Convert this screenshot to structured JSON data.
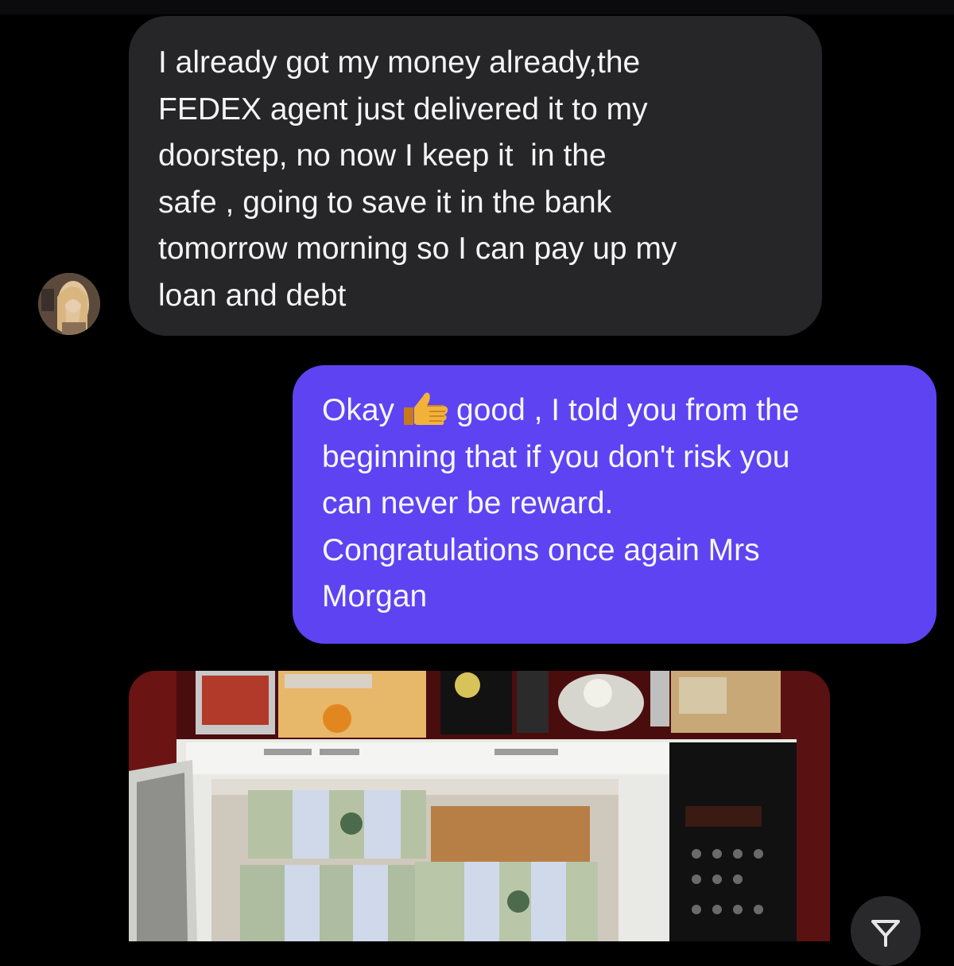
{
  "conversation": {
    "incoming": {
      "lines": [
        "I already got my money already,the",
        "FEDEX agent just delivered it to my",
        "doorstep, no now I keep it  in the",
        "safe , going to save it in the bank",
        "tomorrow morning so I can pay up my",
        "loan and debt"
      ],
      "avatar_icon": "contact-avatar"
    },
    "outgoing": {
      "line1_before": "Okay",
      "line1_emoji": "thumbs-up-emoji",
      "line1_after": "good , I told you from the",
      "lines": [
        "beginning that if you don't risk you",
        "can never be reward.",
        "Congratulations once again Mrs",
        "Morgan"
      ]
    },
    "attachment": {
      "type": "photo",
      "icon": "photo-attachment"
    },
    "share_icon": "share-icon"
  },
  "colors": {
    "background": "#000000",
    "incoming_bubble": "#262629",
    "outgoing_bubble": "#5e43f2",
    "text": "#f4f4f4"
  }
}
